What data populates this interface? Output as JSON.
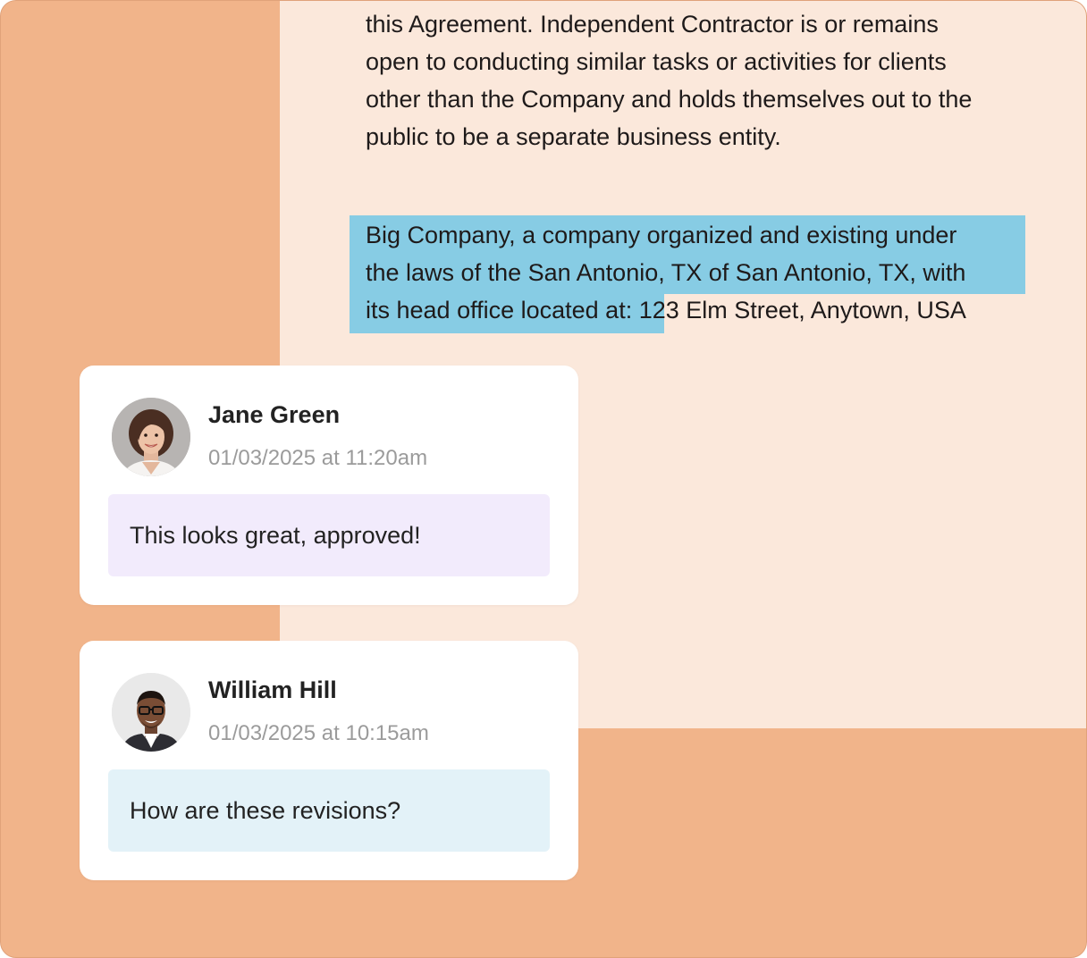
{
  "document": {
    "paragraph1_lines": [
      "this Agreement. Independent Contractor is or remains",
      "open to conducting similar tasks or activities for clients",
      "other than the Company and holds themselves out to the",
      "public to be a separate business entity."
    ],
    "paragraph2": {
      "line1": "Big Company, a company organized and existing under",
      "line2": "the laws of the San Antonio, TX of San Antonio, TX, with",
      "line3_highlighted": "its head office located at:",
      "line3_rest": " 123 Elm Street, Anytown, USA"
    },
    "highlight_color": "#87cce4"
  },
  "comments": [
    {
      "author": "Jane Green",
      "timestamp": "01/03/2025 at 11:20am",
      "message": "This looks great, approved!",
      "avatar_icon": "woman-avatar-icon",
      "bubble_color": "#f2ebfc"
    },
    {
      "author": "William Hill",
      "timestamp": "01/03/2025 at 10:15am",
      "message": "How are these revisions?",
      "avatar_icon": "man-avatar-icon",
      "bubble_color": "#e3f2f8"
    }
  ],
  "colors": {
    "frame_background": "#f1b48a",
    "document_background": "#fbe8db"
  }
}
